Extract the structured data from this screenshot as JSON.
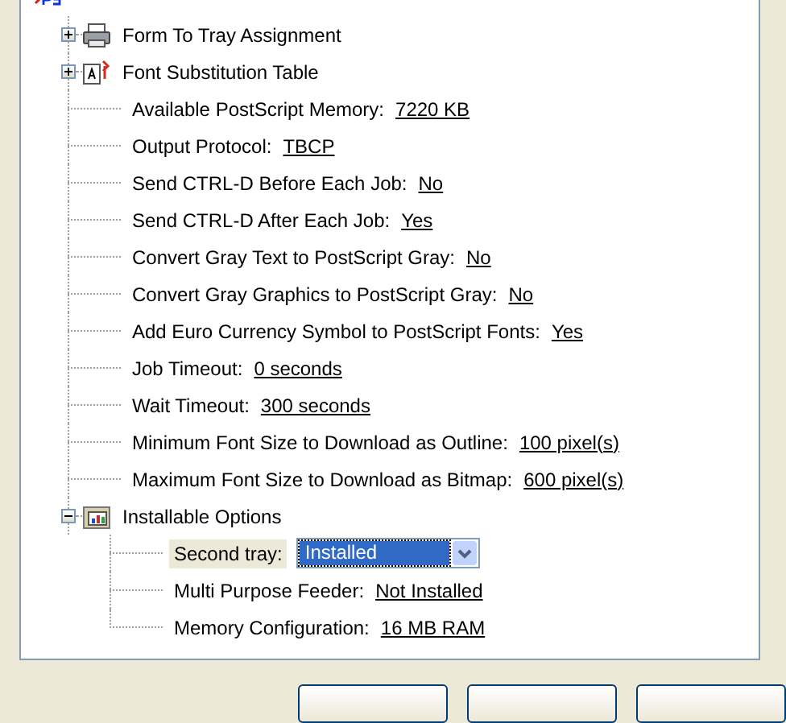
{
  "tree": {
    "items": [
      {
        "kind": "group",
        "label": "Form To Tray Assignment",
        "expanded": false,
        "selected": false
      },
      {
        "kind": "group",
        "label": "Font Substitution Table",
        "expanded": false,
        "selected": false
      },
      {
        "kind": "setting",
        "label": "Available PostScript Memory:",
        "value": "7220 KB",
        "selected": false
      },
      {
        "kind": "setting",
        "label": "Output Protocol:",
        "value": "TBCP",
        "selected": false
      },
      {
        "kind": "setting",
        "label": "Send CTRL-D Before Each Job:",
        "value": "No",
        "selected": false
      },
      {
        "kind": "setting",
        "label": "Send CTRL-D After Each Job:",
        "value": "Yes",
        "selected": false
      },
      {
        "kind": "setting",
        "label": "Convert Gray Text to PostScript Gray:",
        "value": "No",
        "selected": false
      },
      {
        "kind": "setting",
        "label": "Convert Gray Graphics to PostScript Gray:",
        "value": "No",
        "selected": false
      },
      {
        "kind": "setting",
        "label": "Add Euro Currency Symbol to PostScript Fonts:",
        "value": "Yes",
        "selected": false
      },
      {
        "kind": "setting",
        "label": "Job Timeout:",
        "value": "0 seconds",
        "selected": false
      },
      {
        "kind": "setting",
        "label": "Wait Timeout:",
        "value": "300 seconds",
        "selected": false
      },
      {
        "kind": "setting",
        "label": "Minimum Font Size to Download as Outline:",
        "value": "100 pixel(s)",
        "selected": false
      },
      {
        "kind": "setting",
        "label": "Maximum Font Size to Download as Bitmap:",
        "value": "600 pixel(s)",
        "selected": false
      },
      {
        "kind": "group",
        "label": "Installable Options",
        "expanded": true,
        "selected": false,
        "children": [
          {
            "kind": "dropdown",
            "label": "Second tray:",
            "value": "Installed",
            "selected": true
          },
          {
            "kind": "setting",
            "label": "Multi Purpose Feeder:",
            "value": "Not Installed",
            "selected": false
          },
          {
            "kind": "setting",
            "label": "Memory Configuration:",
            "value": "16 MB RAM",
            "selected": false
          }
        ]
      }
    ]
  },
  "buttons": [
    {
      "kind": "push"
    },
    {
      "kind": "push"
    },
    {
      "kind": "push"
    }
  ]
}
